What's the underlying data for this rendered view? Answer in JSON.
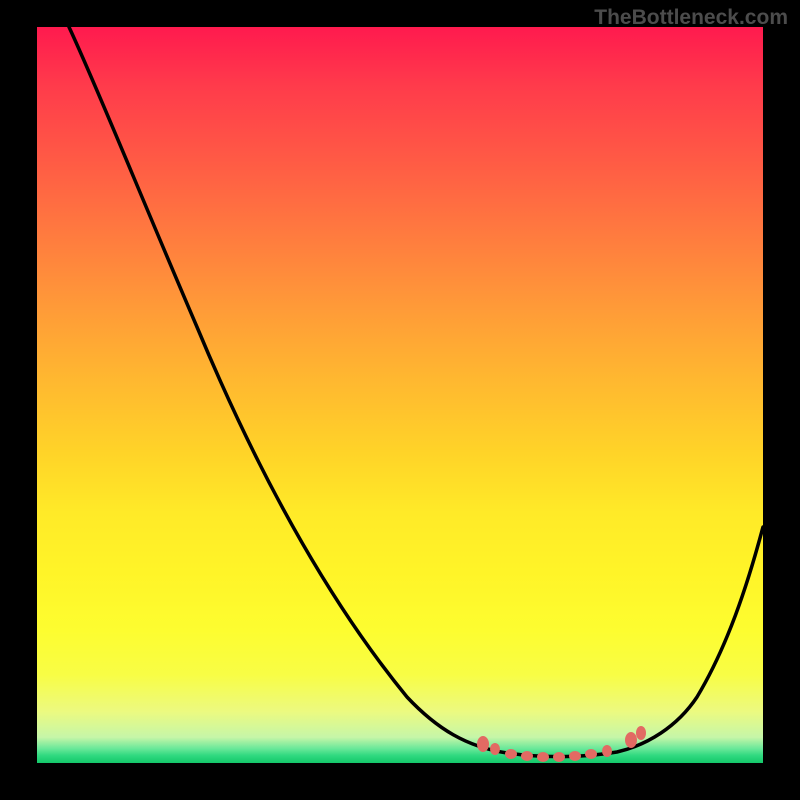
{
  "watermark": "TheBottleneck.com",
  "chart_data": {
    "type": "line",
    "title": "",
    "xlabel": "",
    "ylabel": "",
    "xlim": [
      0,
      100
    ],
    "ylim": [
      0,
      100
    ],
    "grid": false,
    "legend": false,
    "series": [
      {
        "name": "bottleneck-curve",
        "color": "#000000",
        "x": [
          4,
          10,
          22,
          35,
          45,
          51,
          57,
          62,
          65,
          70,
          75,
          80,
          84,
          88,
          92,
          96,
          100
        ],
        "y": [
          100,
          90,
          68,
          46,
          30,
          20,
          12,
          6,
          3,
          1.5,
          1,
          1.5,
          3,
          6,
          12,
          22,
          32
        ]
      }
    ],
    "markers": {
      "name": "optimal-range",
      "color": "#e26a63",
      "x": [
        61,
        63,
        65,
        67,
        69,
        71,
        73,
        75,
        78,
        82,
        83
      ],
      "y": [
        2.6,
        1.9,
        1.3,
        1.0,
        0.9,
        0.9,
        1.0,
        1.3,
        1.6,
        3.1,
        4.1
      ]
    },
    "background_gradient": {
      "type": "vertical",
      "stops": [
        {
          "pos": 0.0,
          "color": "#ff1a4e"
        },
        {
          "pos": 0.5,
          "color": "#ffb830"
        },
        {
          "pos": 0.8,
          "color": "#fdfd30"
        },
        {
          "pos": 0.97,
          "color": "#6ce89a"
        },
        {
          "pos": 1.0,
          "color": "#14c86a"
        }
      ]
    }
  }
}
